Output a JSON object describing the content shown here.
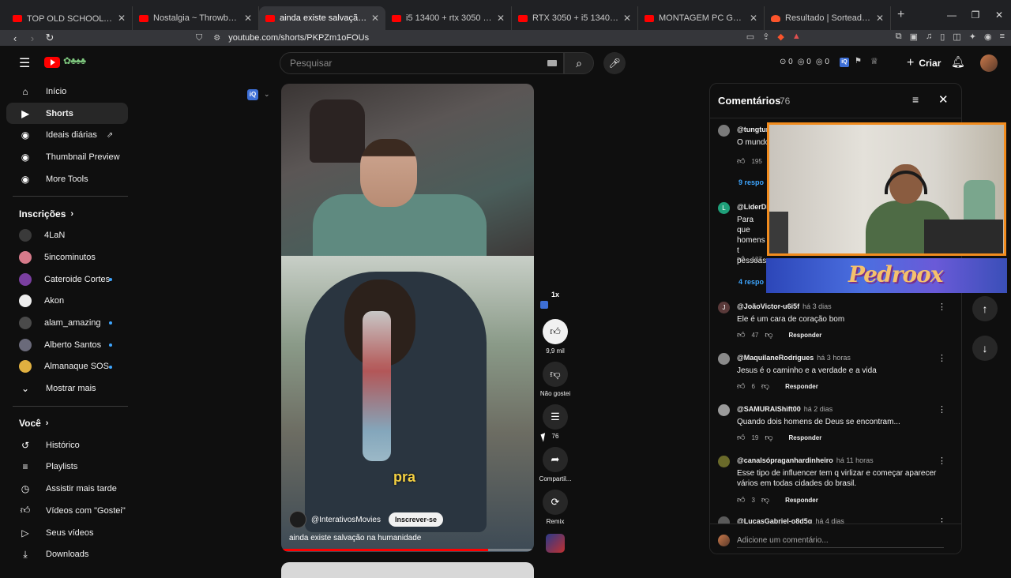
{
  "browser": {
    "tabs": [
      {
        "title": "TOP OLD SCHOOL HIP HOP🔥🔥 Ice",
        "active": false,
        "icon": "youtube-icon"
      },
      {
        "title": "Nostalgia ~ Throwback R&B Classics",
        "active": false,
        "icon": "youtube-icon"
      },
      {
        "title": "ainda existe salvação na humanidade",
        "active": true,
        "icon": "youtube-icon"
      },
      {
        "title": "i5 13400 + rtx 3050 benchmark - You",
        "active": false,
        "icon": "youtube-icon"
      },
      {
        "title": "RTX 3050 + i5 13400F - Test in 18 Games",
        "active": false,
        "icon": "youtube-icon"
      },
      {
        "title": "MONTAGEM PC GAMER INTEL GIGA",
        "active": false,
        "icon": "youtube-icon"
      },
      {
        "title": "Resultado | Sorteador.com.br - O Site",
        "active": false,
        "icon": "sorteador-icon"
      }
    ],
    "url": "youtube.com/shorts/PKPZm1oFOUs"
  },
  "masthead": {
    "search_placeholder": "Pesquisar",
    "counters": [
      "0",
      "0",
      "0"
    ],
    "create_label": "Criar"
  },
  "sidebar": {
    "main": [
      {
        "label": "Início",
        "icon": "home-icon",
        "active": false
      },
      {
        "label": "Shorts",
        "icon": "shorts-icon",
        "active": true
      },
      {
        "label": "Ideais diárias",
        "icon": "extension-icon",
        "active": false,
        "external": true
      },
      {
        "label": "Thumbnail Preview",
        "icon": "extension-icon",
        "active": false
      },
      {
        "label": "More Tools",
        "icon": "extension-icon",
        "active": false
      }
    ],
    "subscriptions_title": "Inscrições",
    "subscriptions": [
      {
        "label": "4LaN",
        "color": "#3a3a3a",
        "new": false
      },
      {
        "label": "5incominutos",
        "color": "#d67a8a",
        "new": false
      },
      {
        "label": "Cateroide Cortes",
        "color": "#7a3fa0",
        "new": true
      },
      {
        "label": "Akon",
        "color": "#eeeeee",
        "new": false
      },
      {
        "label": "alam_amazing",
        "color": "#4a4a4a",
        "new": true
      },
      {
        "label": "Alberto Santos",
        "color": "#6a6a7a",
        "new": true
      },
      {
        "label": "Almanaque SOS",
        "color": "#e0b040",
        "new": true
      }
    ],
    "show_more": "Mostrar mais",
    "you_title": "Você",
    "you": [
      {
        "label": "Histórico",
        "icon": "history-icon"
      },
      {
        "label": "Playlists",
        "icon": "playlists-icon"
      },
      {
        "label": "Assistir mais tarde",
        "icon": "watch-later-icon"
      },
      {
        "label": "Vídeos com \"Gostei\"",
        "icon": "thumbs-up-icon"
      },
      {
        "label": "Seus vídeos",
        "icon": "your-videos-icon"
      },
      {
        "label": "Downloads",
        "icon": "download-icon"
      }
    ]
  },
  "short": {
    "caption_word": "pra",
    "channel": "@InterativosMovies",
    "subscribe_label": "Inscrever-se",
    "title": "ainda existe salvação na humanidade",
    "progress": 0.82,
    "speed": "1x",
    "actions": {
      "likes": "9,9 mil",
      "dislike": "Não gostei",
      "comments": "76",
      "share": "Compartil...",
      "remix": "Remix"
    }
  },
  "comments": {
    "title": "Comentários",
    "count": "76",
    "input_placeholder": "Adicione um comentário...",
    "items": [
      {
        "author": "@tungtun",
        "time": "",
        "text": "O mundo",
        "likes": "195",
        "avatar_color": "#7a7a7a",
        "initial": "",
        "replies": "9 respo"
      },
      {
        "author": "@LiderDig",
        "time": "",
        "text": "Para que homens t pessoas",
        "likes": "127",
        "avatar_color": "#1fa07a",
        "initial": "L",
        "replies": "4 respo"
      },
      {
        "author": "@JoãoVictor-u6i5f",
        "time": "há 3 dias",
        "text": "Ele é um cara de coração bom",
        "likes": "47",
        "avatar_color": "#5a3a3a",
        "initial": "J",
        "replies": ""
      },
      {
        "author": "@MaquilaneRodrigues",
        "time": "há 3 horas",
        "text": "Jesus é o caminho e a verdade e a vida",
        "likes": "6",
        "avatar_color": "#8a8a8a",
        "initial": "",
        "replies": ""
      },
      {
        "author": "@SAMURAIShift00",
        "time": "há 2 dias",
        "text": "Quando dois homens de Deus se encontram...",
        "likes": "19",
        "avatar_color": "#9a9a9a",
        "initial": "",
        "replies": ""
      },
      {
        "author": "@canalsópraganhardinheiro",
        "time": "há 11 horas",
        "text": "Esse tipo de influencer tem q virlizar e começar aparecer vários em todas cidades do brasil.",
        "likes": "3",
        "avatar_color": "#6a6a2a",
        "initial": "",
        "replies": ""
      },
      {
        "author": "@LucasGabriel-o8d5g",
        "time": "há 4 dias",
        "text": "",
        "likes": "",
        "avatar_color": "#5a5a5a",
        "initial": "",
        "replies": ""
      }
    ],
    "reply_label": "Responder"
  },
  "overlay": {
    "banner_text": "Pedroox"
  }
}
